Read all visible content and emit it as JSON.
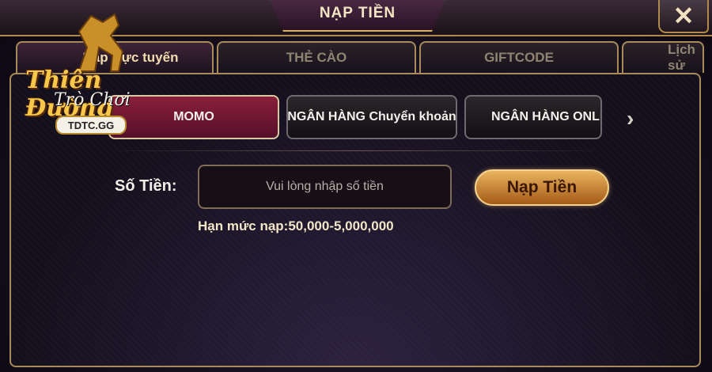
{
  "header": {
    "title": "NẠP TIỀN",
    "close_symbol": "✕"
  },
  "tabs": [
    {
      "label": "Nạp trực tuyến",
      "active": true
    },
    {
      "label": "THẺ CÀO"
    },
    {
      "label": "GIFTCODE"
    },
    {
      "label": "Lịch sử"
    }
  ],
  "methods": [
    {
      "label": "MOMO",
      "active": true
    },
    {
      "label": "NGÂN HÀNG Chuyển khoản"
    },
    {
      "label": "NGÂN HÀNG ONLINE"
    }
  ],
  "form": {
    "amount_label": "Số Tiền:",
    "amount_placeholder": "Vui lòng nhập số tiền",
    "submit_label": "Nạp Tiền",
    "limit_text": "Hạn mức nạp:50,000-5,000,000"
  },
  "logo": {
    "title": "Thiên Đường",
    "subtitle": "Trò Chơi",
    "badge": "TDTC.GG"
  },
  "colors": {
    "accent_gold": "#d9b26a",
    "active_method": "#8a1f3b",
    "button_gold": "#e9b45f"
  }
}
